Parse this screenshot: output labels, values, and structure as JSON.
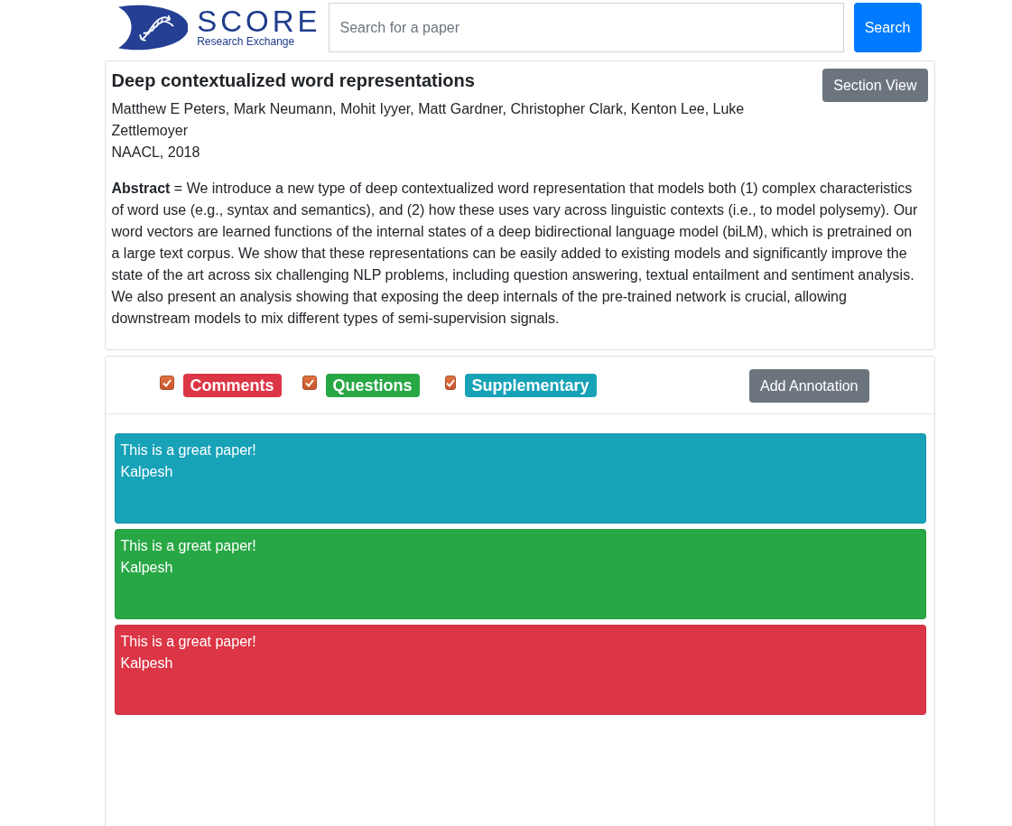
{
  "header": {
    "logo": {
      "title": "SCORE",
      "subtitle": "Research Exchange"
    },
    "search": {
      "placeholder": "Search for a paper"
    },
    "search_button": "Search"
  },
  "paper": {
    "title": "Deep contextualized word representations",
    "section_view_button": "Section View",
    "authors": "Matthew E Peters, Mark Neumann, Mohit Iyyer, Matt Gardner, Christopher Clark, Kenton Lee, Luke Zettlemoyer",
    "venue": "NAACL, 2018",
    "abstract": "**Abstract** = We introduce a new type of deep contextualized word representation that models both (1) complex characteristics of word use (e.g., syntax and semantics), and (2) how these uses vary across linguistic contexts (i.e., to model polysemy). Our word vectors are learned functions of the internal states of a deep bidirectional language model (biLM), which is pretrained on a large text corpus. We show that these representations can be easily added to existing models and significantly improve the state of the art across six challenging NLP problems, including question answering, textual entailment and sentiment analysis. We also present an analysis showing that exposing the deep internals of the pre-trained network is crucial, allowing downstream models to mix different types of semi-supervision signals."
  },
  "annotations": {
    "filters": [
      {
        "label": "Comments",
        "checked": true,
        "color": "#dc3545"
      },
      {
        "label": "Questions",
        "checked": true,
        "color": "#28a745"
      },
      {
        "label": "Supplementary",
        "checked": true,
        "color": "#17a2b8"
      }
    ],
    "add_button": "Add Annotation",
    "items": [
      {
        "text": "This is a great paper!",
        "author": "Kalpesh",
        "color": "#17a2b8"
      },
      {
        "text": "This is a great paper!",
        "author": "Kalpesh",
        "color": "#28a745"
      },
      {
        "text": "This is a great paper!",
        "author": "Kalpesh",
        "color": "#dc3545"
      }
    ]
  }
}
